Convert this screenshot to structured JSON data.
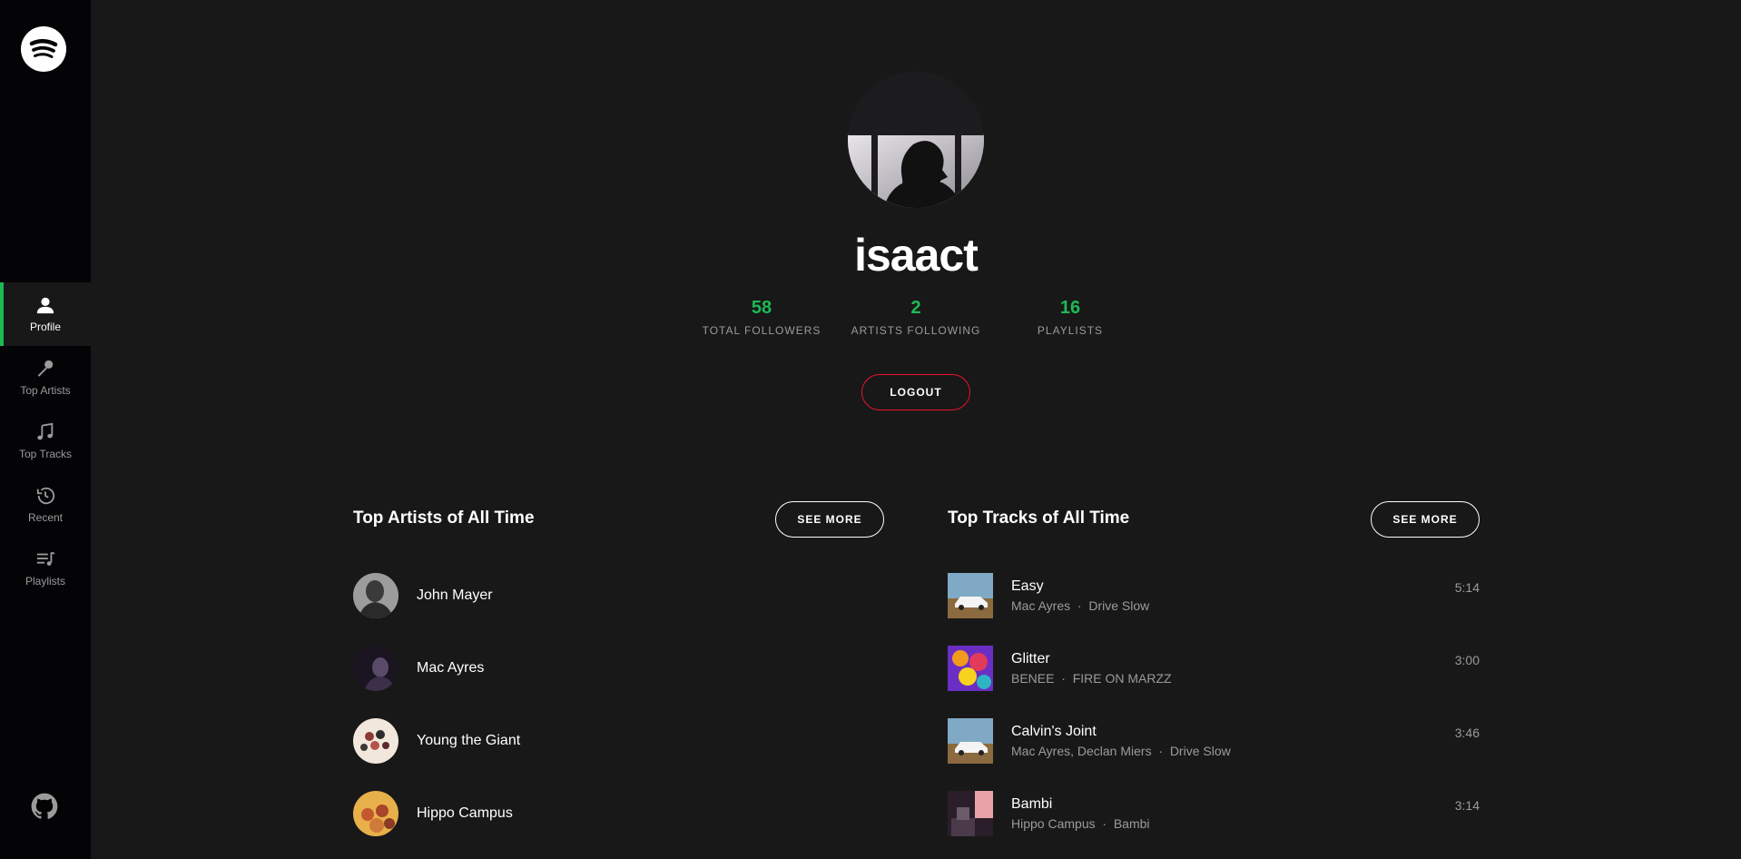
{
  "sidebar": {
    "items": [
      {
        "label": "Profile",
        "icon": "user-icon"
      },
      {
        "label": "Top Artists",
        "icon": "microphone-icon"
      },
      {
        "label": "Top Tracks",
        "icon": "music-note-icon"
      },
      {
        "label": "Recent",
        "icon": "history-icon"
      },
      {
        "label": "Playlists",
        "icon": "playlist-icon"
      }
    ]
  },
  "profile": {
    "username": "isaact",
    "stats": [
      {
        "value": "58",
        "label": "Total Followers"
      },
      {
        "value": "2",
        "label": "Artists Following"
      },
      {
        "value": "16",
        "label": "Playlists"
      }
    ],
    "logout_label": "LOGOUT"
  },
  "top_artists": {
    "title": "Top Artists of All Time",
    "see_more": "SEE MORE",
    "items": [
      {
        "name": "John Mayer"
      },
      {
        "name": "Mac Ayres"
      },
      {
        "name": "Young the Giant"
      },
      {
        "name": "Hippo Campus"
      }
    ]
  },
  "top_tracks": {
    "title": "Top Tracks of All Time",
    "see_more": "SEE MORE",
    "items": [
      {
        "name": "Easy",
        "artist": "Mac Ayres",
        "album": "Drive Slow",
        "duration": "5:14"
      },
      {
        "name": "Glitter",
        "artist": "BENEE",
        "album": "FIRE ON MARZZ",
        "duration": "3:00"
      },
      {
        "name": "Calvin's Joint",
        "artist": "Mac Ayres, Declan Miers",
        "album": "Drive Slow",
        "duration": "3:46"
      },
      {
        "name": "Bambi",
        "artist": "Hippo Campus",
        "album": "Bambi",
        "duration": "3:14"
      }
    ],
    "separator": "·"
  },
  "colors": {
    "accent": "#1db954",
    "danger": "#e91429",
    "background": "#181818",
    "sidebar": "#040306",
    "muted": "#9b9b9b"
  }
}
